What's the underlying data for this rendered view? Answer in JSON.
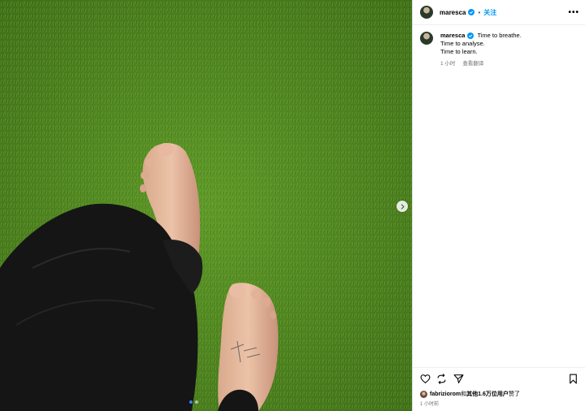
{
  "post": {
    "username": "maresca",
    "follow_label": "关注",
    "separator": "•",
    "more_label": "•••",
    "caption_lines": [
      "Time to breathe.",
      "Time to analyse.",
      "Time to learn."
    ],
    "time_ago": "1 小时",
    "translate_label": "查看翻译",
    "liked_by_user": "fabriziorom",
    "liked_by_mid": "和",
    "liked_by_others": "其他1.6万位用户",
    "liked_by_end": "赞了",
    "posted_time": "1 小时前"
  },
  "media": {
    "carousel_count": 2,
    "carousel_active_index": 0
  },
  "icons": {
    "verified": "verified-badge-icon",
    "like": "heart-icon",
    "repost": "repost-icon",
    "share": "send-icon",
    "save": "bookmark-icon",
    "next": "chevron-right-icon"
  },
  "colors": {
    "accent": "#0095f6",
    "verified": "#0095f6",
    "grass": "#4a7d1e",
    "pants": "#151515"
  }
}
